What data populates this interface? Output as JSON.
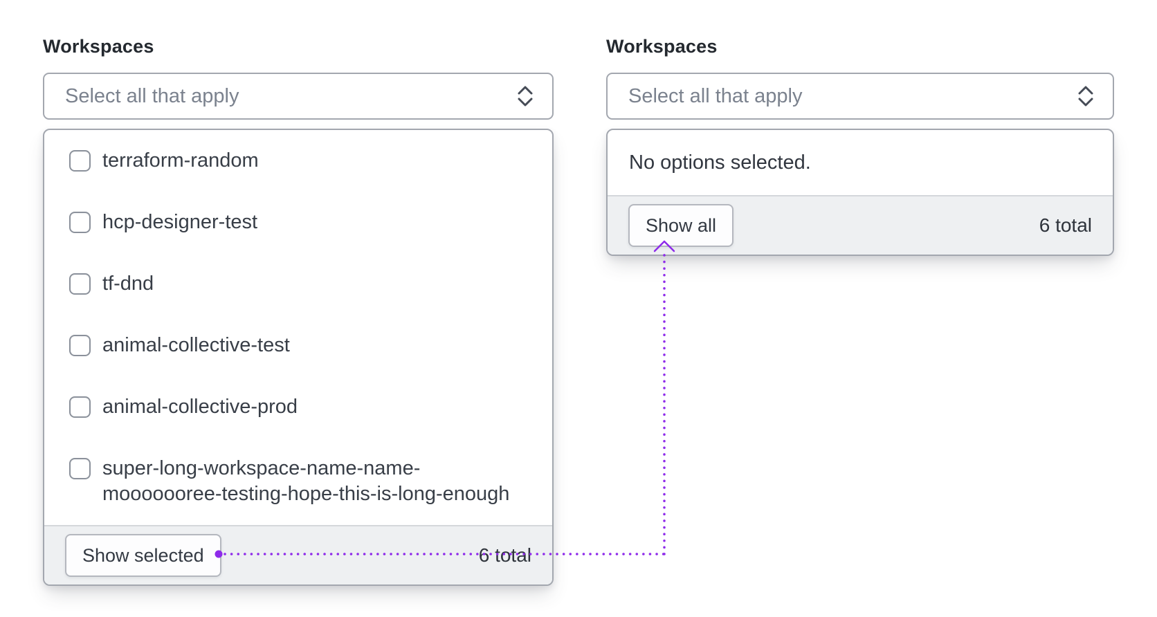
{
  "colors": {
    "accent": "#8e2bea",
    "footer_bg": "#eef0f2",
    "border": "#a3a7af"
  },
  "icons": {
    "trigger_chevron": "chevron-up-down"
  },
  "left": {
    "label": "Workspaces",
    "placeholder": "Select all that apply",
    "options": [
      {
        "label": "terraform-random",
        "checked": false
      },
      {
        "label": "hcp-designer-test",
        "checked": false
      },
      {
        "label": "tf-dnd",
        "checked": false
      },
      {
        "label": "animal-collective-test",
        "checked": false
      },
      {
        "label": "animal-collective-prod",
        "checked": false
      },
      {
        "label": "super-long-workspace-name-name-\nmooooooree-testing-hope-this-is-long-enough",
        "checked": false
      }
    ],
    "footer": {
      "button": "Show selected",
      "total": "6 total"
    }
  },
  "right": {
    "label": "Workspaces",
    "placeholder": "Select all that apply",
    "empty_message": "No options selected.",
    "footer": {
      "button": "Show all",
      "total": "6 total"
    }
  }
}
